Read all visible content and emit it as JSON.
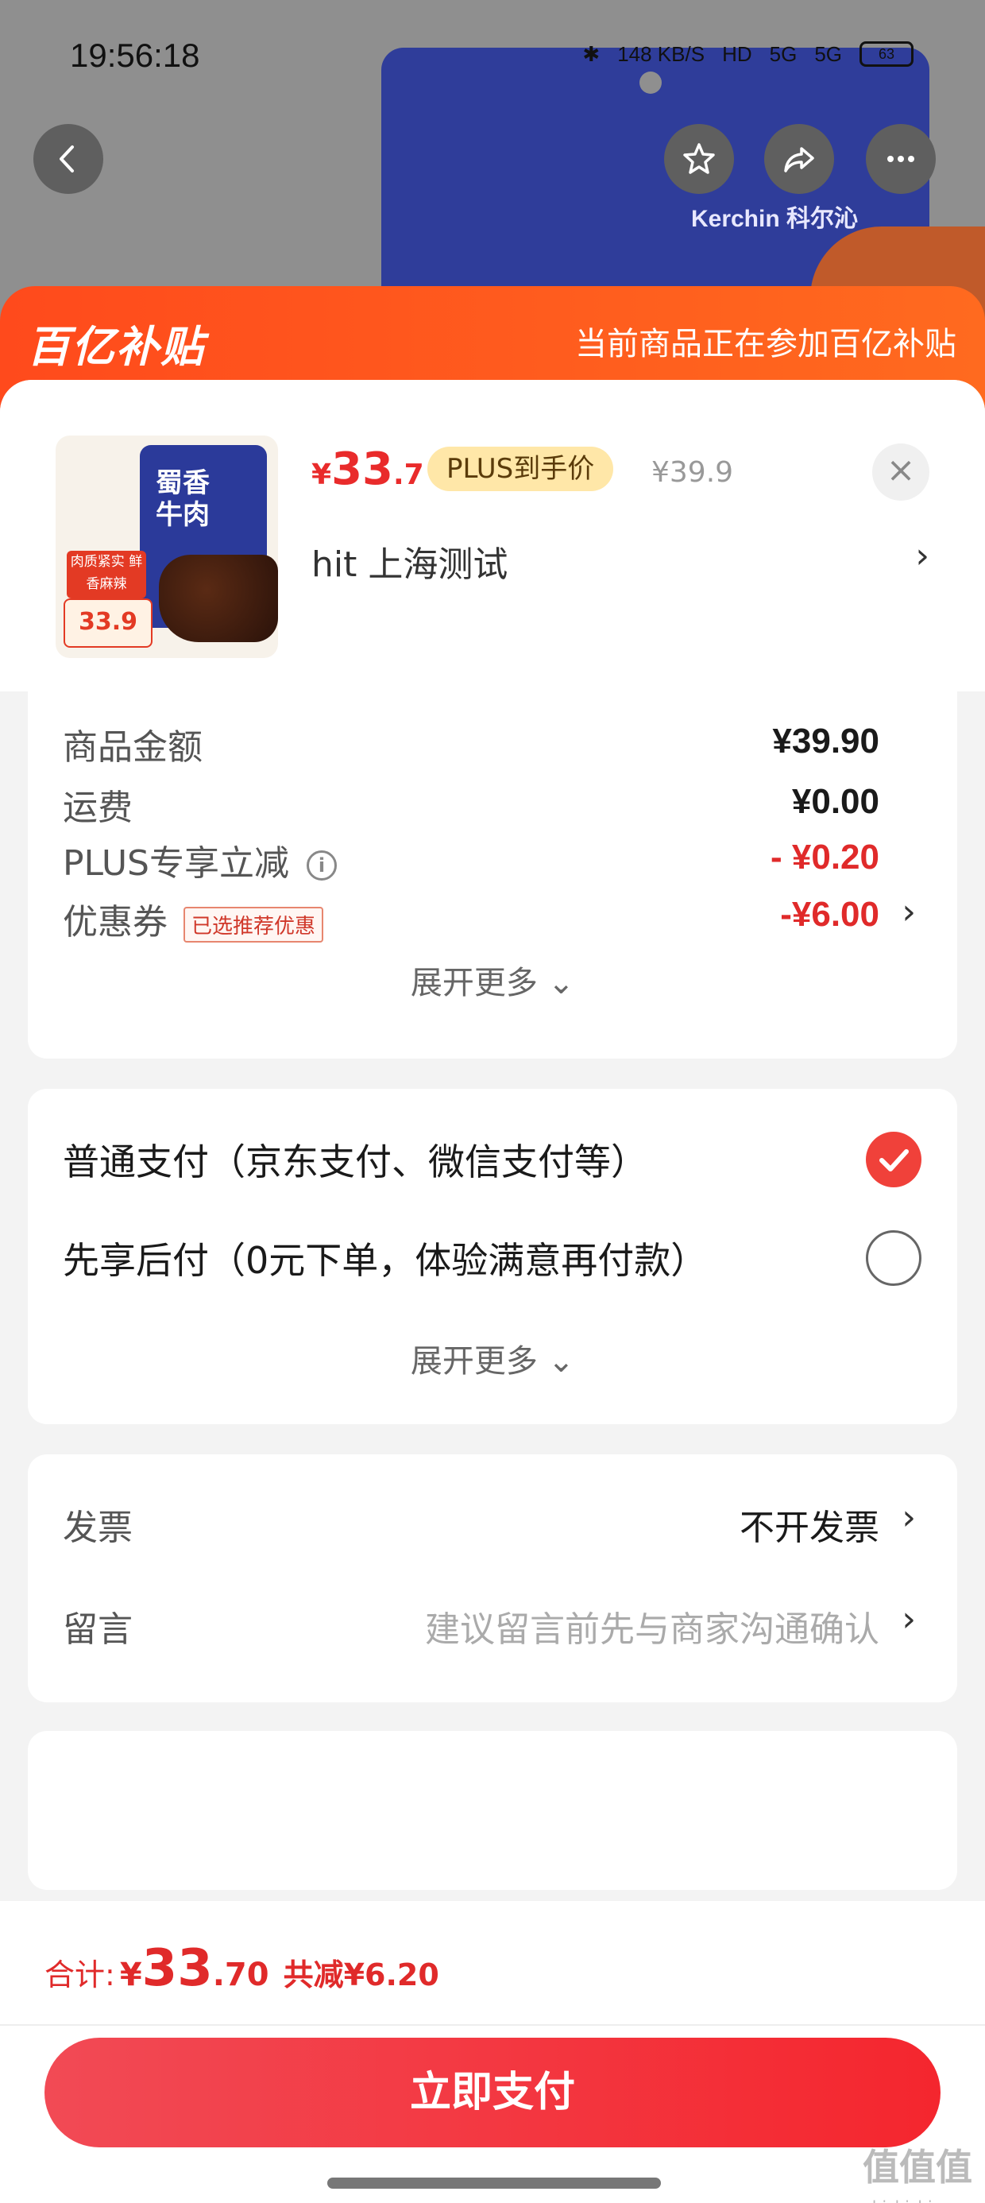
{
  "status_bar": {
    "time": "19:56:18",
    "net_speed": "148 KB/S",
    "hd": "HD",
    "signal1": "5G",
    "signal2": "5G",
    "battery": "63"
  },
  "background": {
    "brand": "Kerchin 科尔沁",
    "pack_title": "蜀香"
  },
  "subsidy": {
    "logo": "百亿补贴",
    "message": "当前商品正在参加百亿补贴"
  },
  "product": {
    "thumb_title": "蜀香牛肉",
    "thumb_tag": "肉质紧实 鲜香麻辣",
    "thumb_price": "33.9",
    "price_yen": "¥",
    "price_int": "33",
    "price_dec": ".7",
    "plus_badge": "PLUS到手价",
    "orig_price": "¥39.9",
    "spec": "hit  上海测试",
    "close_icon": "×"
  },
  "summary": {
    "goods_label": "商品金额",
    "goods_value": "¥39.90",
    "shipping_label": "运费",
    "shipping_value": "¥0.00",
    "plus_label": "PLUS专享立减",
    "plus_value": "- ¥0.20",
    "coupon_label": "优惠券",
    "coupon_tag": "已选推荐优惠",
    "coupon_value": "-¥6.00",
    "expand": "展开更多 ⌄"
  },
  "payment": {
    "normal": "普通支付（京东支付、微信支付等）",
    "later": "先享后付（0元下单，体验满意再付款）",
    "expand": "展开更多 ⌄",
    "selected": "normal"
  },
  "extras": {
    "invoice_label": "发票",
    "invoice_value": "不开发票",
    "message_label": "留言",
    "message_placeholder": "建议留言前先与商家沟通确认"
  },
  "footer": {
    "total_label": "合计:",
    "total_yen": "¥",
    "total_int": "33",
    "total_dec": ".70",
    "total_saving": "共减¥6.20",
    "pay_button": "立即支付",
    "watermark": "值值值",
    "watermark_sub": "zhizhizhi.com"
  },
  "colors": {
    "accent_red": "#e02a2a",
    "banner_orange": "#ff5a1e",
    "plus_gold": "#ffe7a8"
  }
}
